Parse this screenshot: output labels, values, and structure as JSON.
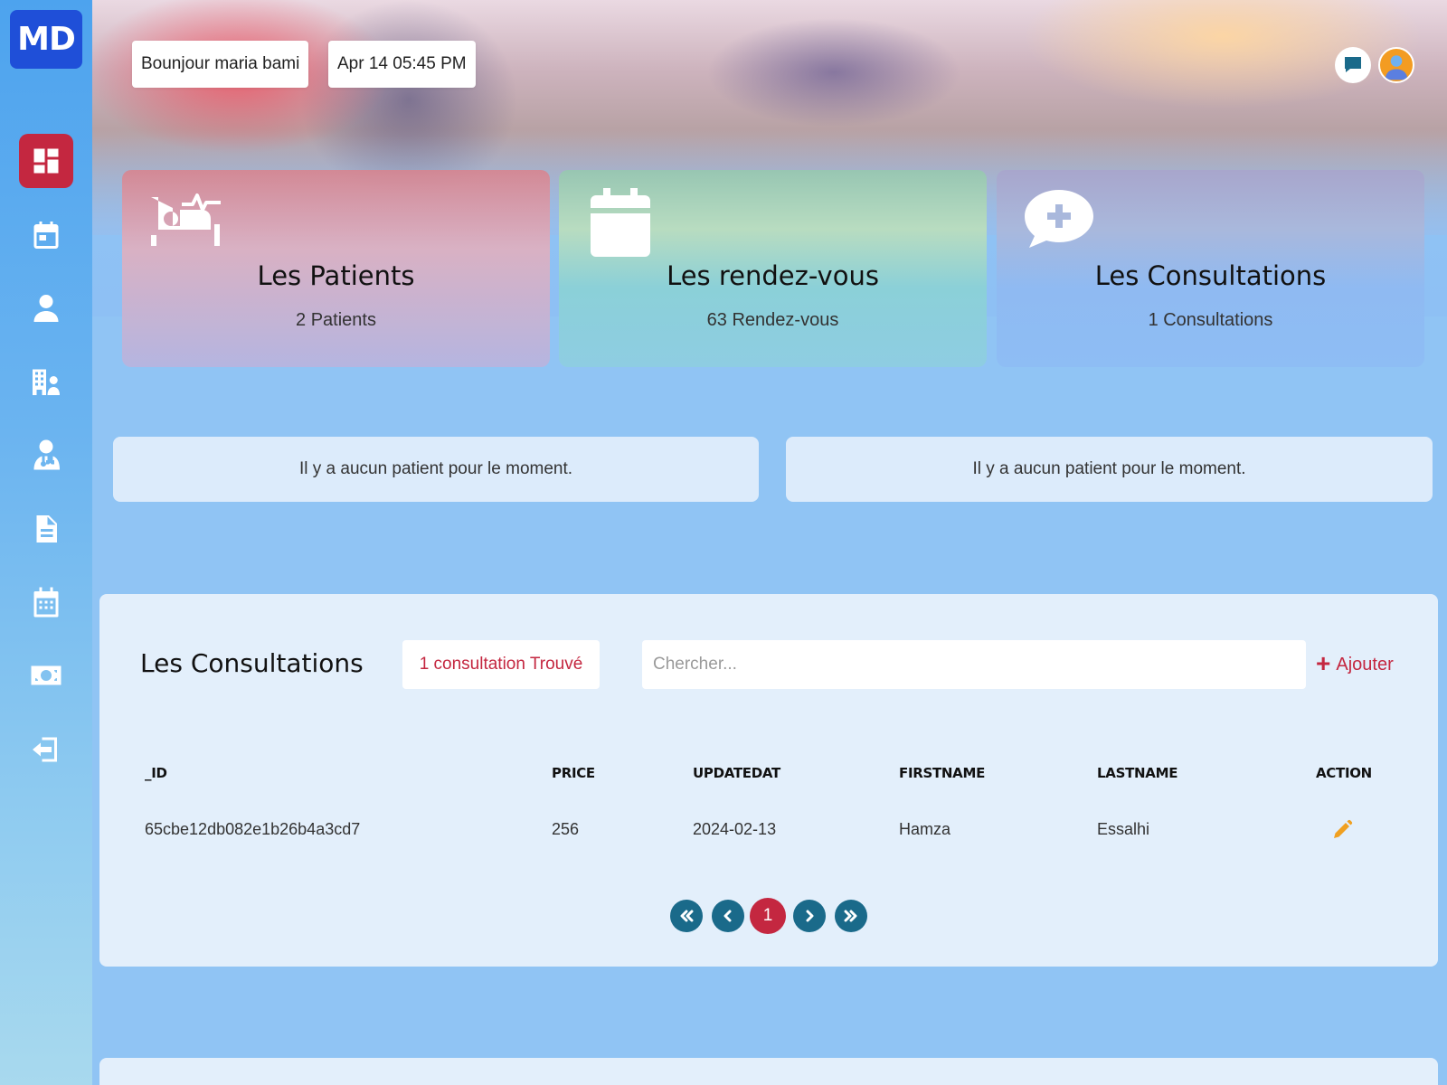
{
  "sidebar": {
    "logo": "MD",
    "items": [
      {
        "icon": "dashboard-icon",
        "active": true
      },
      {
        "icon": "calendar-icon",
        "active": false
      },
      {
        "icon": "user-icon",
        "active": false
      },
      {
        "icon": "hospital-user-icon",
        "active": false
      },
      {
        "icon": "doctor-icon",
        "active": false
      },
      {
        "icon": "document-icon",
        "active": false
      },
      {
        "icon": "calendar-days-icon",
        "active": false
      },
      {
        "icon": "money-icon",
        "active": false
      },
      {
        "icon": "logout-icon",
        "active": false
      }
    ]
  },
  "header": {
    "greeting": "Bounjour maria bami",
    "datetime": "Apr 14 05:45 PM",
    "icons": [
      "chat-icon",
      "avatar"
    ]
  },
  "cards": [
    {
      "icon": "bed-pulse-icon",
      "title": "Les Patients",
      "subtitle": "2 Patients"
    },
    {
      "icon": "calendar-icon",
      "title": "Les rendez-vous",
      "subtitle": "63 Rendez-vous"
    },
    {
      "icon": "comment-medical-icon",
      "title": "Les Consultations",
      "subtitle": "1 Consultations"
    }
  ],
  "notices": [
    "Il y a aucun patient pour le moment.",
    "Il y a aucun patient pour le moment."
  ],
  "consultations": {
    "title": "Les Consultations",
    "found": "1 consultation Trouvé",
    "search_placeholder": "Chercher...",
    "add_label": "Ajouter",
    "columns": [
      "_ID",
      "PRICE",
      "UPDATEDAT",
      "FIRSTNAME",
      "LASTNAME",
      "ACTION"
    ],
    "rows": [
      [
        "65cbe12db082e1b26b4a3cd7",
        "256",
        "2024-02-13",
        "Hamza",
        "Essalhi"
      ]
    ],
    "pagination": {
      "current": "1"
    }
  },
  "colors": {
    "accent": "#c42740",
    "logo": "#1f4fd8",
    "pagination": "#1a6a8a",
    "edit": "#f0a020"
  }
}
